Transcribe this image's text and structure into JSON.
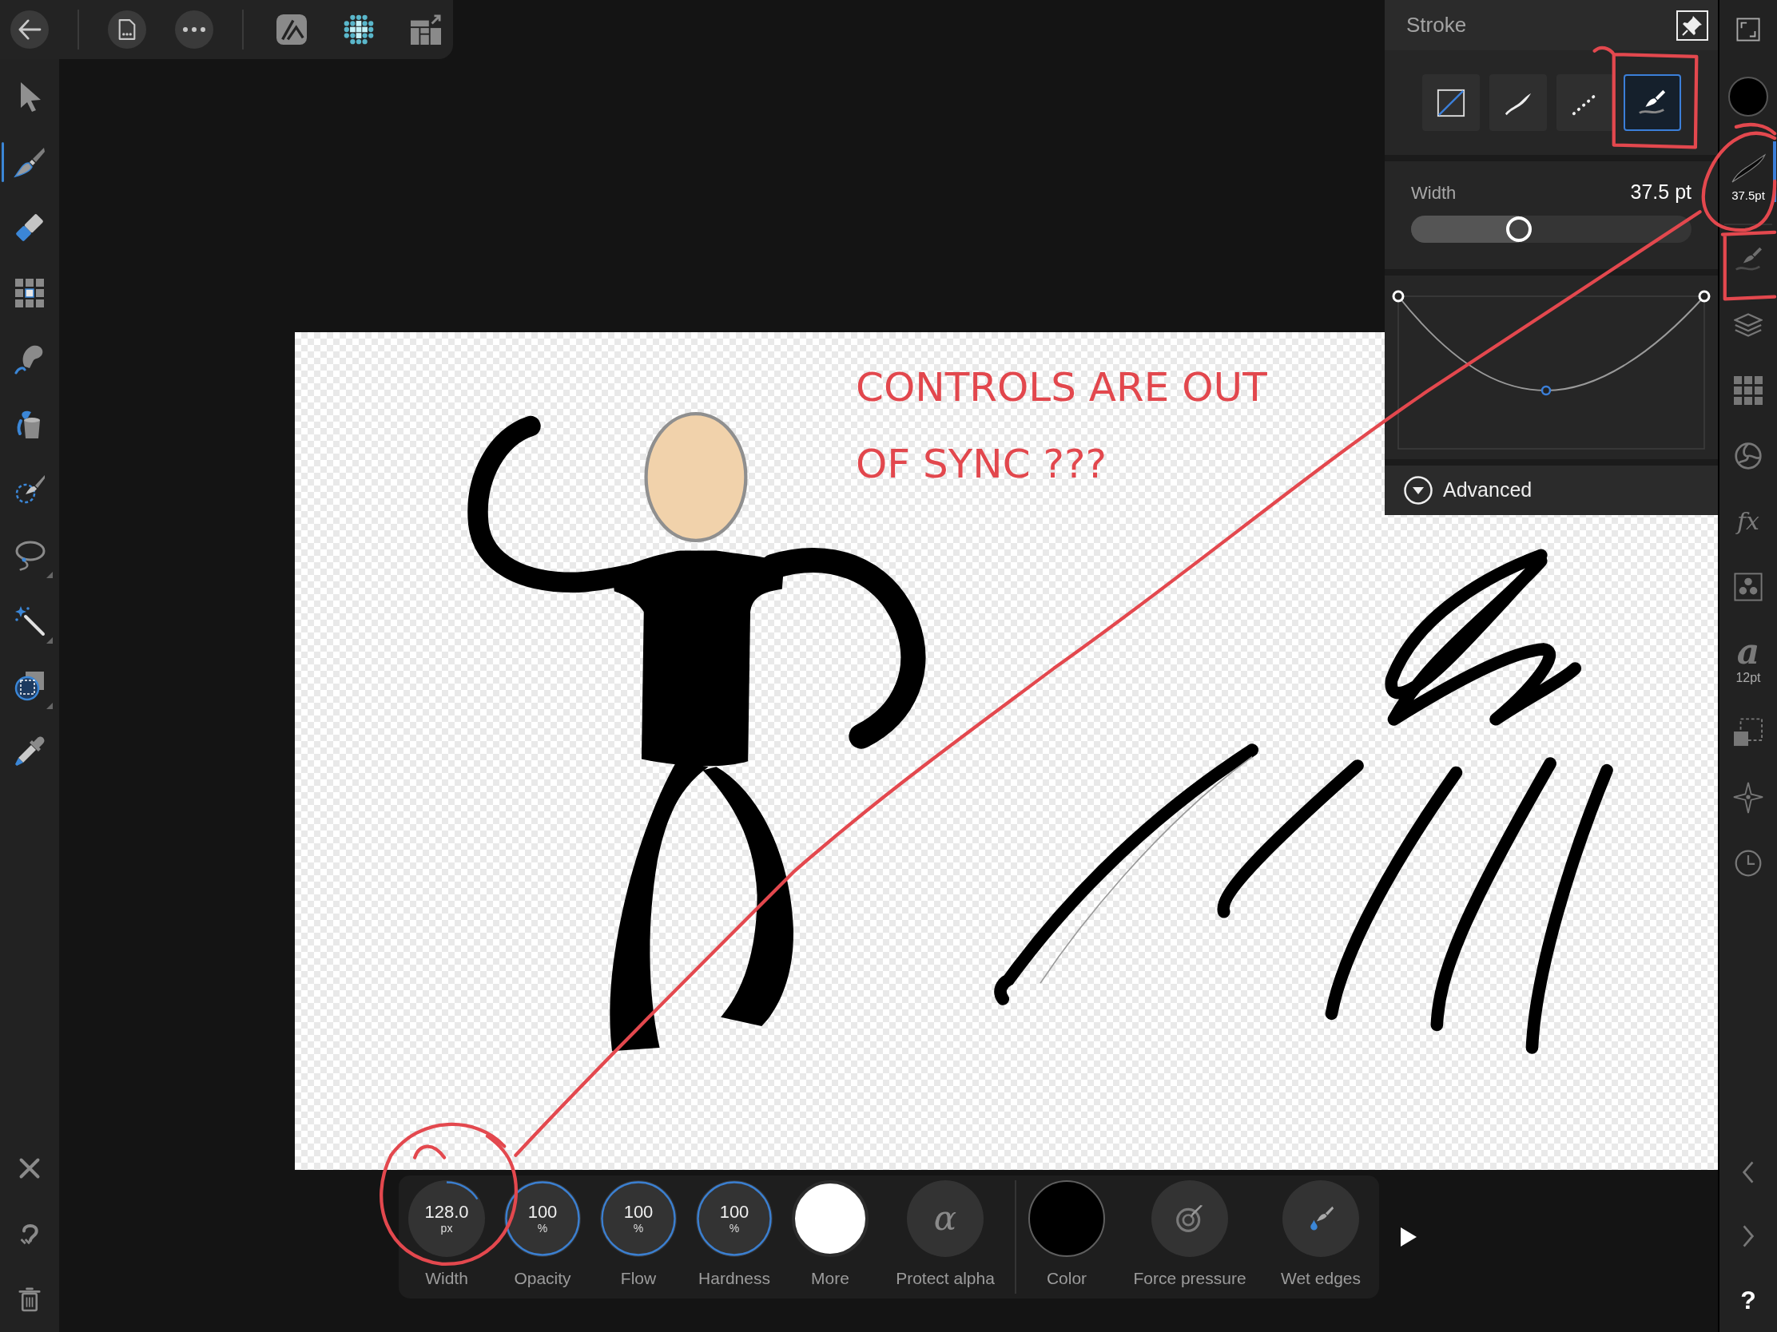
{
  "top_toolbar": {
    "personas": [
      {
        "kind": "photo",
        "selected": false
      },
      {
        "kind": "pixel",
        "selected": true
      },
      {
        "kind": "export",
        "selected": false
      }
    ]
  },
  "tools": [
    {
      "kind": "move",
      "selected": false,
      "flyout": false
    },
    {
      "kind": "paint",
      "selected": true,
      "flyout": false
    },
    {
      "kind": "erase",
      "selected": false,
      "flyout": false
    },
    {
      "kind": "grid",
      "selected": false,
      "flyout": false
    },
    {
      "kind": "smudge",
      "selected": false,
      "flyout": false
    },
    {
      "kind": "fill",
      "selected": false,
      "flyout": false
    },
    {
      "kind": "selectbrush",
      "selected": false,
      "flyout": false
    },
    {
      "kind": "lasso",
      "selected": false,
      "flyout": true
    },
    {
      "kind": "wand",
      "selected": false,
      "flyout": true
    },
    {
      "kind": "marquee",
      "selected": false,
      "flyout": true
    },
    {
      "kind": "picker",
      "selected": false,
      "flyout": false
    }
  ],
  "stroke_panel": {
    "title": "Stroke",
    "stroke_types": [
      {
        "kind": "none",
        "selected": false
      },
      {
        "kind": "solid",
        "selected": false
      },
      {
        "kind": "dashed",
        "selected": false
      },
      {
        "kind": "brush",
        "selected": true
      }
    ],
    "width": {
      "label": "Width",
      "value": "37.5 pt",
      "level": 0.385
    },
    "advanced": {
      "label": "Advanced",
      "expanded": false
    }
  },
  "studio_bar": {
    "groups": [
      [
        {
          "kind": "color",
          "selected": false,
          "color": "#000000"
        },
        {
          "kind": "stroke",
          "selected": true,
          "label": "37.5pt"
        }
      ],
      [
        {
          "kind": "brush",
          "selected": false
        },
        {
          "kind": "layers",
          "selected": false
        },
        {
          "kind": "swatches",
          "selected": false
        },
        {
          "kind": "adjustments",
          "selected": false
        },
        {
          "kind": "effects",
          "selected": false,
          "glyph": "fx"
        },
        {
          "kind": "styles",
          "selected": false
        },
        {
          "kind": "text",
          "selected": false,
          "glyph": "a",
          "label": "12pt"
        },
        {
          "kind": "transform",
          "selected": false
        },
        {
          "kind": "navigator",
          "selected": false
        },
        {
          "kind": "history",
          "selected": false
        }
      ]
    ],
    "help": "?"
  },
  "canvas": {
    "note": [
      "CONTROLS ARE OUT",
      "OF SYNC ???"
    ]
  },
  "context_toolbar": {
    "groups": [
      [
        {
          "kind": "dial",
          "label": "Width",
          "value": "128.0",
          "unit": "px",
          "level": 0.16
        },
        {
          "kind": "dial",
          "label": "Opacity",
          "value": "100",
          "unit": "%",
          "level": 1
        },
        {
          "kind": "dial",
          "label": "Flow",
          "value": "100",
          "unit": "%",
          "level": 1
        },
        {
          "kind": "dial",
          "label": "Hardness",
          "value": "100",
          "unit": "%",
          "level": 1
        },
        {
          "kind": "preview",
          "label": "More"
        },
        {
          "kind": "alpha",
          "label": "Protect alpha",
          "glyph": "α"
        }
      ],
      [
        {
          "kind": "swatch",
          "label": "Color",
          "color": "#000000"
        },
        {
          "kind": "pressure",
          "label": "Force pressure"
        },
        {
          "kind": "wetedges",
          "label": "Wet edges"
        }
      ]
    ]
  }
}
